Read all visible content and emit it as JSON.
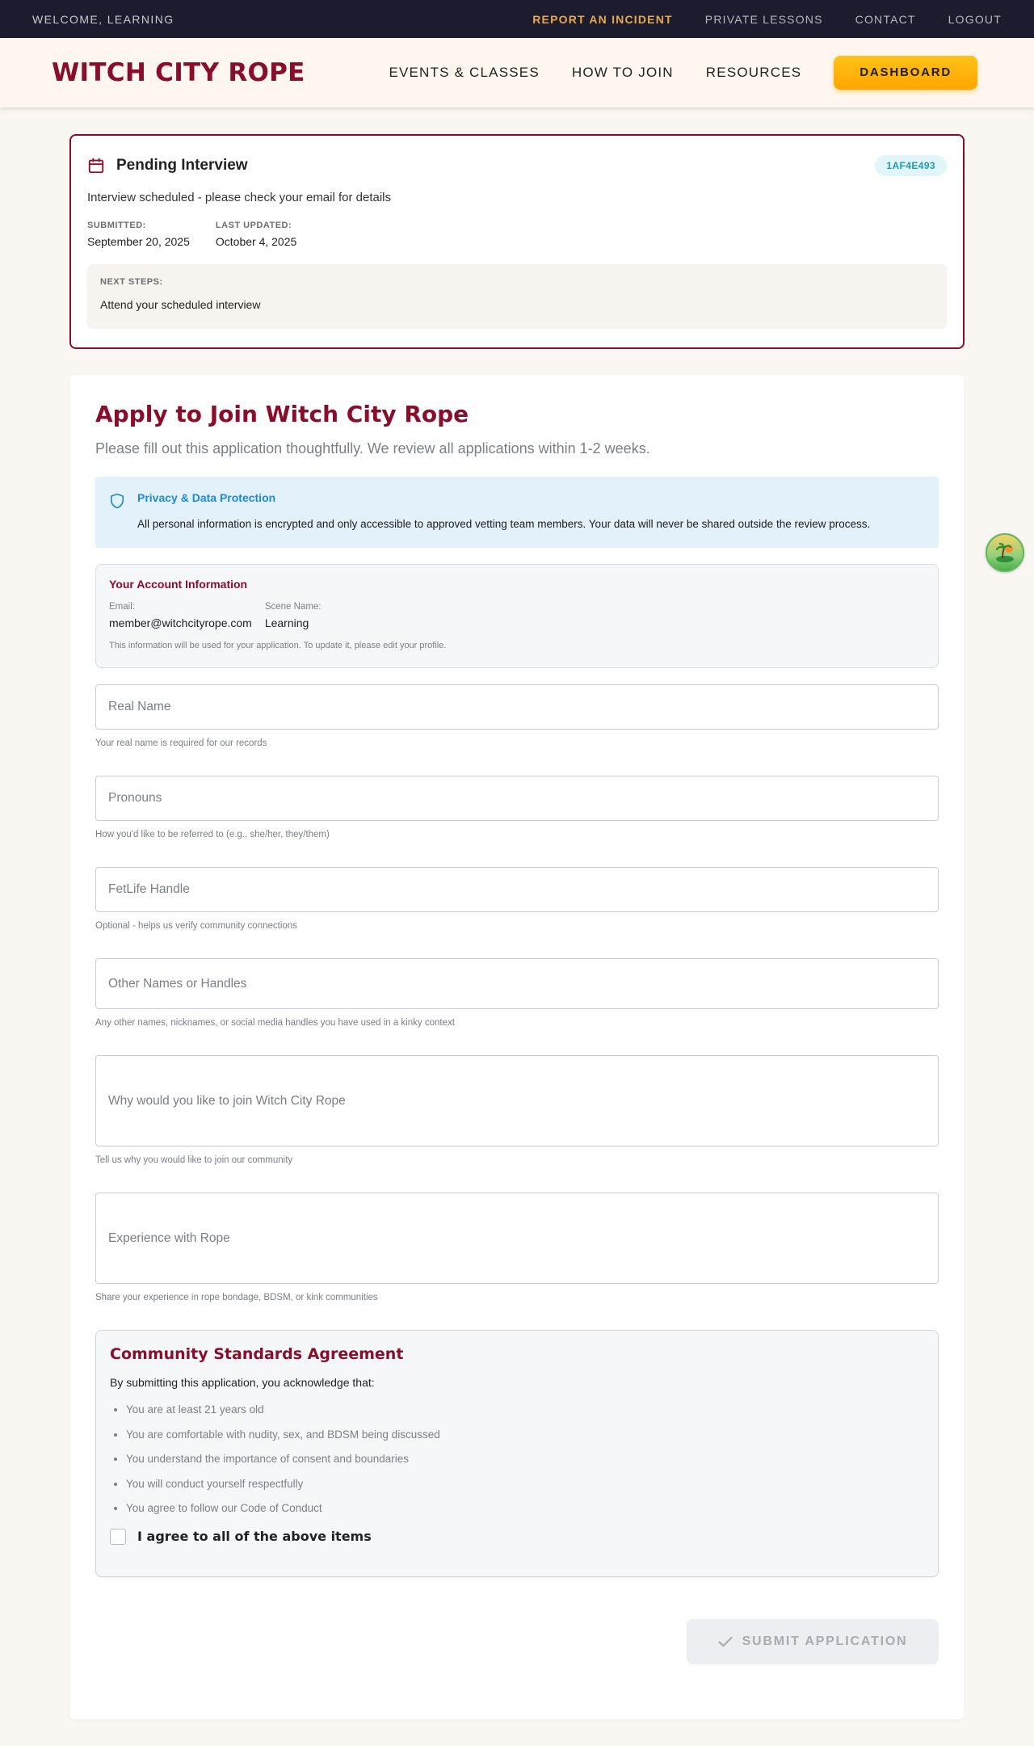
{
  "topbar": {
    "welcome": "WELCOME, LEARNING",
    "links": [
      "REPORT AN INCIDENT",
      "PRIVATE LESSONS",
      "CONTACT",
      "LOGOUT"
    ]
  },
  "nav": {
    "logo": "WITCH CITY ROPE",
    "links": [
      "EVENTS & CLASSES",
      "HOW TO JOIN",
      "RESOURCES"
    ],
    "dashboard": "DASHBOARD"
  },
  "status": {
    "title": "Pending Interview",
    "id": "1AF4E493",
    "message": "Interview scheduled - please check your email for details",
    "submitted_label": "SUBMITTED:",
    "submitted": "September 20, 2025",
    "updated_label": "LAST UPDATED:",
    "updated": "October 4, 2025",
    "next_label": "NEXT STEPS:",
    "next": "Attend your scheduled interview"
  },
  "form": {
    "title": "Apply to Join Witch City Rope",
    "subtitle": "Please fill out this application thoughtfully. We review all applications within 1-2 weeks.",
    "privacy": {
      "title": "Privacy & Data Protection",
      "text": "All personal information is encrypted and only accessible to approved vetting team members. Your data will never be shared outside the review process."
    },
    "account": {
      "title": "Your Account Information",
      "email_label": "Email:",
      "email": "member@witchcityrope.com",
      "scene_label": "Scene Name:",
      "scene": "Learning",
      "note": "This information will be used for your application. To update it, please edit your profile."
    },
    "fields": [
      {
        "placeholder": "Real Name",
        "helper": "Your real name is required for our records"
      },
      {
        "placeholder": "Pronouns",
        "helper": "How you'd like to be referred to (e.g., she/her, they/them)"
      },
      {
        "placeholder": "FetLife Handle",
        "helper": "Optional - helps us verify community connections"
      },
      {
        "placeholder": "Other Names or Handles",
        "helper": "Any other names, nicknames, or social media handles you have used in a kinky context"
      },
      {
        "placeholder": "Why would you like to join Witch City Rope",
        "helper": "Tell us why you would like to join our community"
      },
      {
        "placeholder": "Experience with Rope",
        "helper": "Share your experience in rope bondage, BDSM, or kink communities"
      }
    ],
    "agreement": {
      "title": "Community Standards Agreement",
      "intro": "By submitting this application, you acknowledge that:",
      "items": [
        "You are at least 21 years old",
        "You are comfortable with nudity, sex, and BDSM being discussed",
        "You understand the importance of consent and boundaries",
        "You will conduct yourself respectfully",
        "You agree to follow our Code of Conduct"
      ],
      "checkbox_label": "I agree to all of the above items"
    },
    "submit": "SUBMIT APPLICATION"
  }
}
